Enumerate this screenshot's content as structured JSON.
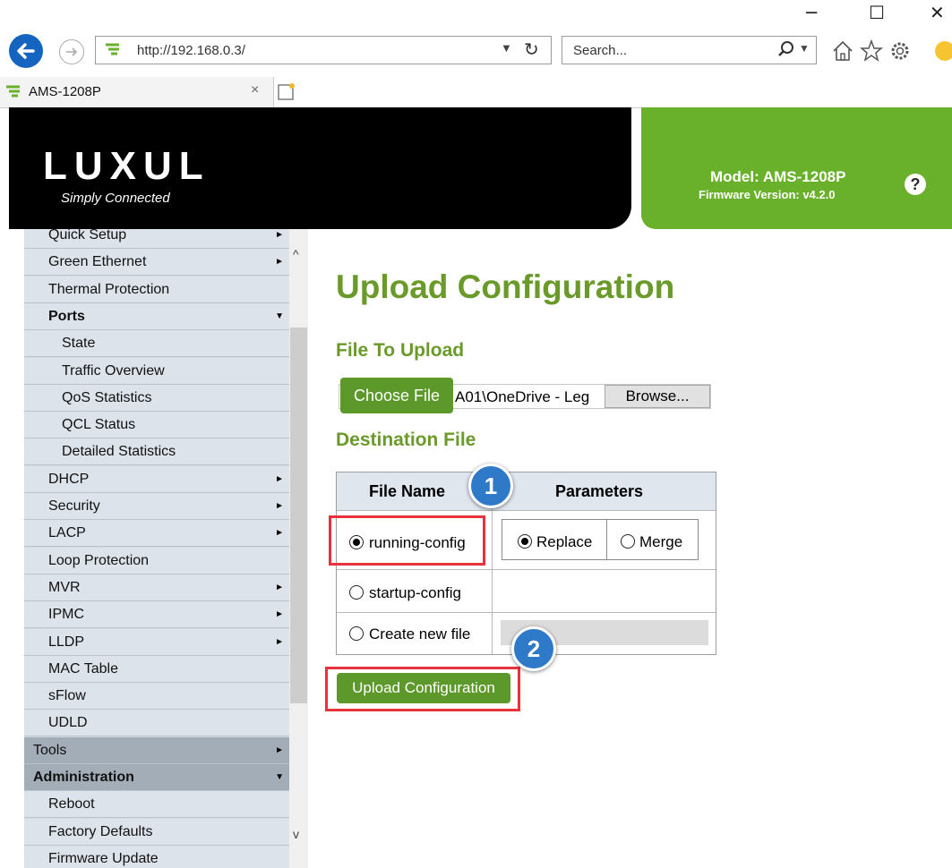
{
  "browser": {
    "address": "http://192.168.0.3/",
    "search_placeholder": "Search...",
    "tab_title": "AMS-1208P",
    "window_controls": {
      "minimize": "─",
      "maximize": "☐",
      "close": "✕"
    }
  },
  "header": {
    "logo_text": "LUXUL",
    "tagline": "Simply Connected",
    "model": "Model: AMS-1208P",
    "firmware": "Firmware Version: v4.2.0",
    "help": "?"
  },
  "sidebar": {
    "items": [
      {
        "label": "Quick Setup",
        "arrow": "►",
        "level": 1
      },
      {
        "label": "Green Ethernet",
        "arrow": "►",
        "level": 1
      },
      {
        "label": "Thermal Protection",
        "arrow": "",
        "level": 1
      },
      {
        "label": "Ports",
        "arrow": "▼",
        "level": 1,
        "bold": true
      },
      {
        "label": "State",
        "arrow": "",
        "level": 2
      },
      {
        "label": "Traffic Overview",
        "arrow": "",
        "level": 2
      },
      {
        "label": "QoS Statistics",
        "arrow": "",
        "level": 2
      },
      {
        "label": "QCL Status",
        "arrow": "",
        "level": 2
      },
      {
        "label": "Detailed Statistics",
        "arrow": "",
        "level": 2
      },
      {
        "label": "DHCP",
        "arrow": "►",
        "level": 1
      },
      {
        "label": "Security",
        "arrow": "►",
        "level": 1
      },
      {
        "label": "LACP",
        "arrow": "►",
        "level": 1
      },
      {
        "label": "Loop Protection",
        "arrow": "",
        "level": 1
      },
      {
        "label": "MVR",
        "arrow": "►",
        "level": 1
      },
      {
        "label": "IPMC",
        "arrow": "►",
        "level": 1
      },
      {
        "label": "LLDP",
        "arrow": "►",
        "level": 1
      },
      {
        "label": "MAC Table",
        "arrow": "",
        "level": 1
      },
      {
        "label": "sFlow",
        "arrow": "",
        "level": 1
      },
      {
        "label": "UDLD",
        "arrow": "",
        "level": 1
      },
      {
        "label": "Tools",
        "arrow": "►",
        "level": 0
      },
      {
        "label": "Administration",
        "arrow": "▼",
        "level": 0,
        "bold": true
      },
      {
        "label": "Reboot",
        "arrow": "",
        "level": 1
      },
      {
        "label": "Factory Defaults",
        "arrow": "",
        "level": 1
      },
      {
        "label": "Firmware Update",
        "arrow": "",
        "level": 1
      }
    ]
  },
  "main": {
    "title": "Upload Configuration",
    "file_section": "File To Upload",
    "choose_file": "Choose File",
    "file_path": "A01\\OneDrive - Leg",
    "browse": "Browse...",
    "dest_section": "Destination File",
    "table": {
      "col_file": "File Name",
      "col_params": "Parameters",
      "rows": [
        {
          "name": "running-config",
          "selected": true
        },
        {
          "name": "startup-config",
          "selected": false
        },
        {
          "name": "Create new file",
          "selected": false
        }
      ],
      "params": [
        {
          "name": "Replace",
          "selected": true
        },
        {
          "name": "Merge",
          "selected": false
        }
      ]
    },
    "upload_button": "Upload Configuration"
  },
  "annotations": {
    "badge1": "1",
    "badge2": "2"
  },
  "colors": {
    "brand_green": "#6ab12b",
    "button_green": "#5d982a",
    "highlight_red": "#e8333c",
    "badge_blue": "#2f79c9"
  }
}
